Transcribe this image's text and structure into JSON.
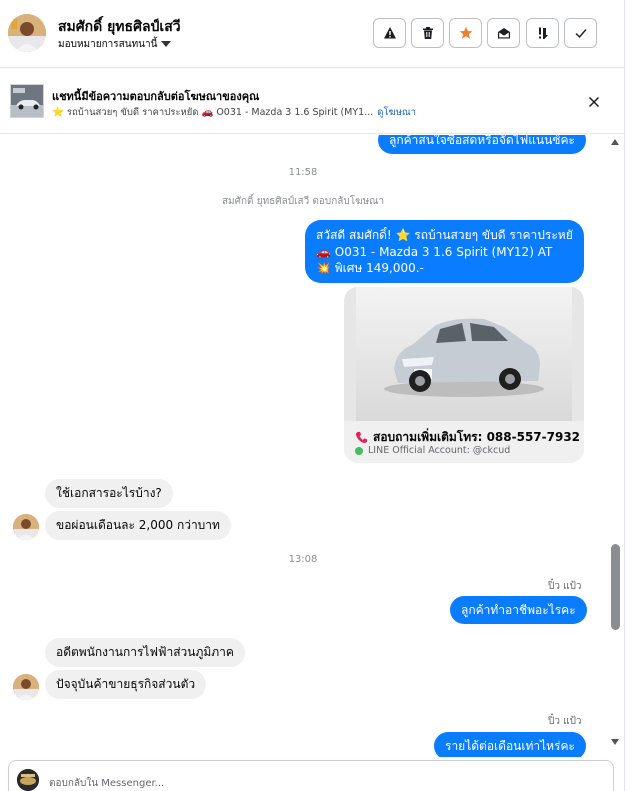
{
  "header": {
    "contact_name": "สมศักดิ์ ยุทธศิลป์เสวี",
    "assign_label": "มอบหมายการสนทนานี้",
    "actions": [
      {
        "name": "report-spam-button",
        "icon": "warning-icon"
      },
      {
        "name": "delete-button",
        "icon": "trash-icon"
      },
      {
        "name": "star-button",
        "icon": "star-icon"
      },
      {
        "name": "mark-unread-button",
        "icon": "envelope-open-icon"
      },
      {
        "name": "mark-followup-button",
        "icon": "important-icon"
      },
      {
        "name": "mark-done-button",
        "icon": "check-icon"
      }
    ],
    "star_color": "#f4802f"
  },
  "ad_banner": {
    "title": "แชทนี้มีข้อความตอบกลับต่อโฆษณาของคุณ",
    "subtitle": "⭐ รถบ้านสวยๆ ขับดี ราคาประหยัด 🚗 O031 - Mazda 3 1.6 Spirit (MY1...",
    "link": "ดูโฆษณา",
    "close_icon": "close-icon"
  },
  "messages": {
    "top_cut_bubble": "ลูกค้าสนใจซื้อสดหรือจัดไฟแนนซ์คะ",
    "time_1": "11:58",
    "ad_reply_note": "สมศักดิ์ ยุทธศิลป์เสวี ตอบกลับโฆษณา",
    "promo_lines": [
      "สวัสดี สมศักดิ์! ⭐ รถบ้านสวยๆ ขับดี ราคาประหยัด",
      "🚗 O031 - Mazda 3 1.6 Spirit (MY12) AT",
      "💥 พิเศษ 149,000.-"
    ],
    "card_phone": "สอบถามเพิ่มเติมโทร: 088-557-7932",
    "card_line": "LINE Official Account: @ckcud",
    "in_1": "ใช้เอกสารอะไรบ้าง?",
    "in_2": "ขอผ่อนเดือนละ 2,000 กว่าบาท",
    "time_2": "13:08",
    "sender_1": "ปิ๋ว แป้ว",
    "out_1": "ลูกค้าทำอาชีพอะไรคะ",
    "in_3": "อดีตพนักงานการไฟฟ้าส่วนภูมิภาค",
    "in_4": "ปัจจุบันค้าขายธุรกิจส่วนตัว",
    "sender_2": "ปิ๋ว แป้ว",
    "out_2_cut": "รายได้ต่อเดือนเท่าไหร่คะ"
  },
  "composer": {
    "placeholder": "ตอบกลับใน Messenger..."
  },
  "colors": {
    "outgoing_bubble": "#0a7cff",
    "incoming_bubble": "#f0f0f0",
    "link": "#1763cf"
  }
}
